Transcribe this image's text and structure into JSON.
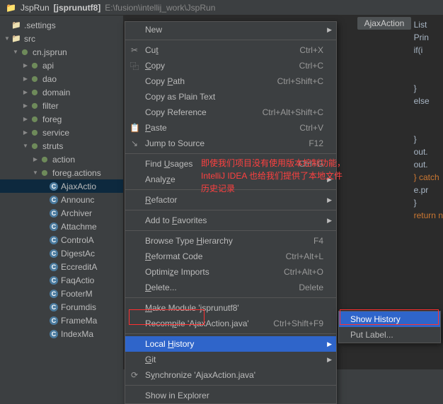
{
  "title": {
    "project": "JspRun",
    "module": "[jsprunutf8]",
    "path": "E:\\fusion\\intellij_work\\JspRun"
  },
  "crumb": "AjaxAction",
  "tree": [
    {
      "indent": 0,
      "arrow": "none",
      "icon": "folder",
      "label": ".settings"
    },
    {
      "indent": 0,
      "arrow": "open",
      "icon": "folder",
      "label": "src"
    },
    {
      "indent": 1,
      "arrow": "open",
      "icon": "package",
      "label": "cn.jsprun"
    },
    {
      "indent": 2,
      "arrow": "closed",
      "icon": "package",
      "label": "api"
    },
    {
      "indent": 2,
      "arrow": "closed",
      "icon": "package",
      "label": "dao"
    },
    {
      "indent": 2,
      "arrow": "closed",
      "icon": "package",
      "label": "domain"
    },
    {
      "indent": 2,
      "arrow": "closed",
      "icon": "package",
      "label": "filter"
    },
    {
      "indent": 2,
      "arrow": "closed",
      "icon": "package",
      "label": "foreg"
    },
    {
      "indent": 2,
      "arrow": "closed",
      "icon": "package",
      "label": "service"
    },
    {
      "indent": 2,
      "arrow": "open",
      "icon": "package",
      "label": "struts"
    },
    {
      "indent": 3,
      "arrow": "closed",
      "icon": "package",
      "label": "action"
    },
    {
      "indent": 3,
      "arrow": "open",
      "icon": "package",
      "label": "foreg.actions"
    },
    {
      "indent": 4,
      "arrow": "none",
      "icon": "class",
      "label": "AjaxActio",
      "selected": true
    },
    {
      "indent": 4,
      "arrow": "none",
      "icon": "class",
      "label": "Announc"
    },
    {
      "indent": 4,
      "arrow": "none",
      "icon": "class",
      "label": "Archiver"
    },
    {
      "indent": 4,
      "arrow": "none",
      "icon": "class",
      "label": "Attachme"
    },
    {
      "indent": 4,
      "arrow": "none",
      "icon": "class",
      "label": "ControlA"
    },
    {
      "indent": 4,
      "arrow": "none",
      "icon": "class",
      "label": "DigestAc"
    },
    {
      "indent": 4,
      "arrow": "none",
      "icon": "class",
      "label": "EccreditA"
    },
    {
      "indent": 4,
      "arrow": "none",
      "icon": "class",
      "label": "FaqActio"
    },
    {
      "indent": 4,
      "arrow": "none",
      "icon": "class",
      "label": "FooterM"
    },
    {
      "indent": 4,
      "arrow": "none",
      "icon": "class",
      "label": "Forumdis"
    },
    {
      "indent": 4,
      "arrow": "none",
      "icon": "class",
      "label": "FrameMa"
    },
    {
      "indent": 4,
      "arrow": "none",
      "icon": "class",
      "label": "IndexMa"
    }
  ],
  "code": [
    {
      "text": "List"
    },
    {
      "text": "Prin"
    },
    {
      "text": "if(i"
    },
    {
      "text": ""
    },
    {
      "text": ""
    },
    {
      "text": "}"
    },
    {
      "text": "else"
    },
    {
      "text": ""
    },
    {
      "text": ""
    },
    {
      "text": "}"
    },
    {
      "text": "out."
    },
    {
      "text": "out."
    },
    {
      "kw": "} ",
      "rest": "catch"
    },
    {
      "text": "e.pr"
    },
    {
      "text": "}"
    },
    {
      "kw": "return ",
      "rest": "n"
    }
  ],
  "menu": [
    {
      "label": "New",
      "arrow": true
    },
    {
      "sep": true
    },
    {
      "icon": "✂",
      "label": "Cut",
      "under": "t",
      "shortcut": "Ctrl+X"
    },
    {
      "icon": "⿻",
      "label": "Copy",
      "under": "C",
      "shortcut": "Ctrl+C"
    },
    {
      "label": "Copy Path",
      "under": "P",
      "shortcut": "Ctrl+Shift+C"
    },
    {
      "label": "Copy as Plain Text"
    },
    {
      "label": "Copy Reference",
      "shortcut": "Ctrl+Alt+Shift+C"
    },
    {
      "icon": "📋",
      "label": "Paste",
      "under": "P",
      "shortcut": "Ctrl+V"
    },
    {
      "icon": "↘",
      "label": "Jump to Source",
      "shortcut": "F12"
    },
    {
      "sep": true
    },
    {
      "label": "Find Usages",
      "under": "U",
      "shortcut": "Ctrl+G"
    },
    {
      "label": "Analyze",
      "under": "z",
      "arrow": true
    },
    {
      "sep": true
    },
    {
      "label": "Refactor",
      "under": "R",
      "arrow": true
    },
    {
      "sep": true
    },
    {
      "label": "Add to Favorites",
      "under": "F",
      "arrow": true
    },
    {
      "sep": true
    },
    {
      "label": "Browse Type Hierarchy",
      "under": "H",
      "shortcut": "F4"
    },
    {
      "label": "Reformat Code",
      "under": "R",
      "shortcut": "Ctrl+Alt+L"
    },
    {
      "label": "Optimize Imports",
      "under": "z",
      "shortcut": "Ctrl+Alt+O"
    },
    {
      "label": "Delete...",
      "under": "D",
      "shortcut": "Delete"
    },
    {
      "sep": true
    },
    {
      "label": "Make Module 'jsprunutf8'",
      "under": "M"
    },
    {
      "label": "Recompile 'AjaxAction.java'",
      "under": "p",
      "shortcut": "Ctrl+Shift+F9"
    },
    {
      "sep": true
    },
    {
      "label": "Local History",
      "under": "H",
      "arrow": true,
      "highlighted": true
    },
    {
      "label": "Git",
      "under": "G",
      "arrow": true
    },
    {
      "icon": "⟳",
      "label": "Synchronize 'AjaxAction.java'",
      "under": "y"
    },
    {
      "sep": true
    },
    {
      "label": "Show in Explorer"
    }
  ],
  "submenu": [
    {
      "label": "Show History",
      "highlighted": true
    },
    {
      "label": "Put Label..."
    }
  ],
  "annotation": {
    "line1": "即使我们项目没有使用版本控制功能，",
    "line2": "IntelliJ IDEA 也给我们提供了本地文件",
    "line3": "历史记录"
  }
}
